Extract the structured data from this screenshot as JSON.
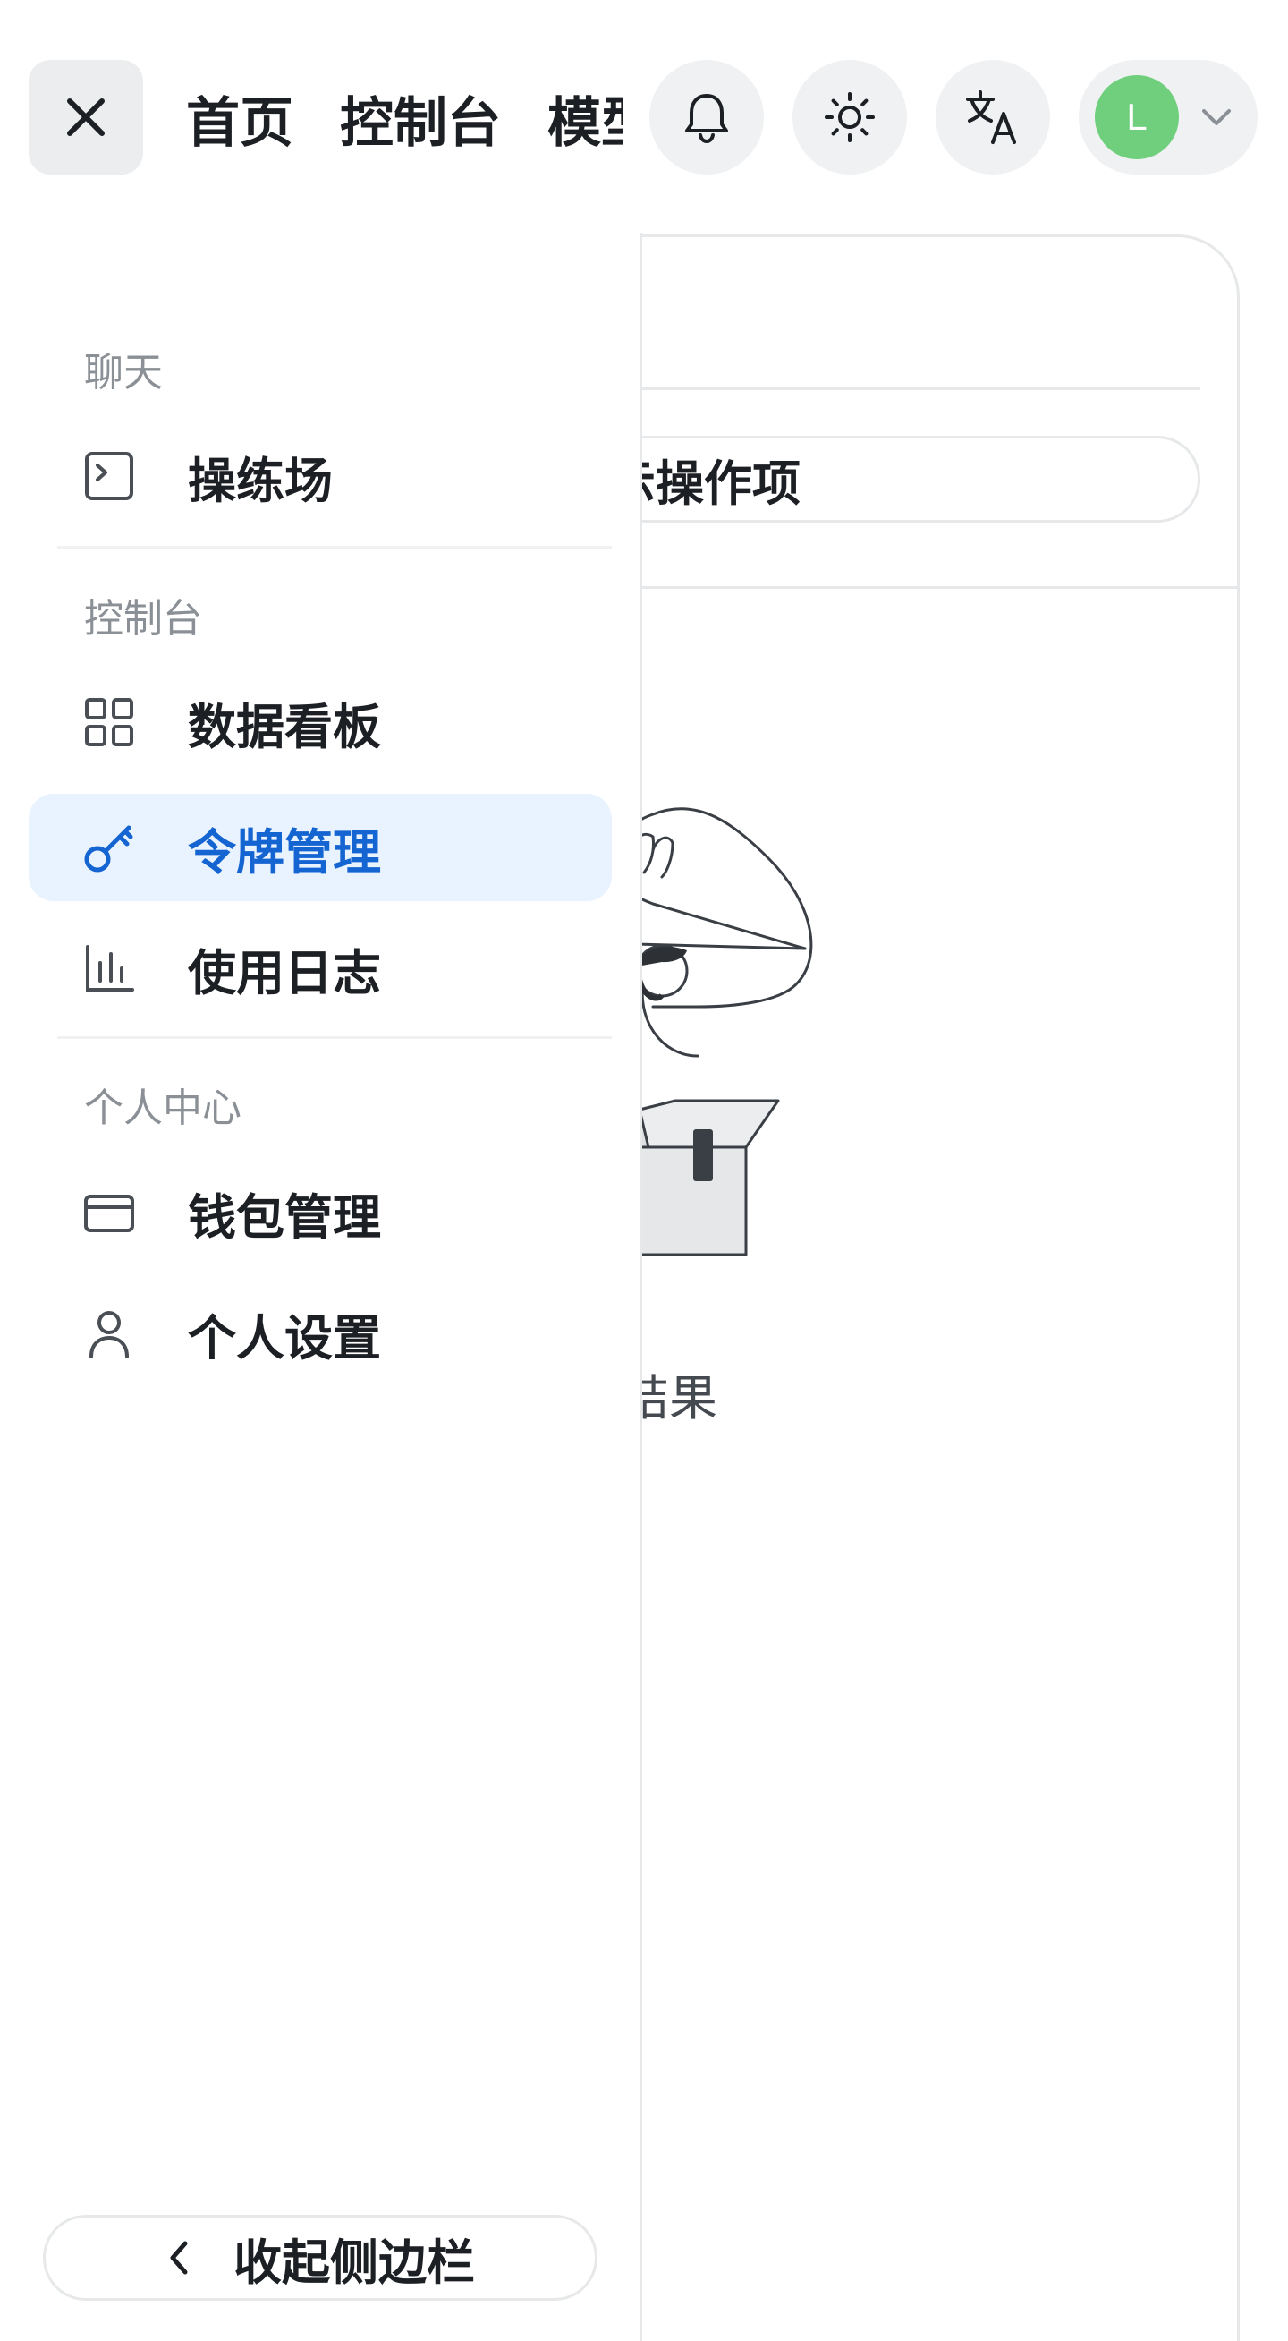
{
  "header": {
    "nav_links": [
      "首页",
      "控制台",
      "模型广场"
    ],
    "avatar_initial": "L",
    "icons": {
      "close": "close-icon",
      "notifications": "bell-icon",
      "theme": "sun-icon",
      "language": "translate-icon",
      "user_menu": "chevron-down-icon"
    }
  },
  "sidebar": {
    "groups": [
      {
        "title": "聊天",
        "items": [
          {
            "label": "操练场",
            "icon": "terminal-icon"
          }
        ]
      },
      {
        "title": "控制台",
        "items": [
          {
            "label": "数据看板",
            "icon": "dashboard-icon"
          },
          {
            "label": "令牌管理",
            "icon": "key-icon",
            "active": true
          },
          {
            "label": "使用日志",
            "icon": "bar-chart-icon"
          }
        ]
      },
      {
        "title": "个人中心",
        "items": [
          {
            "label": "钱包管理",
            "icon": "credit-card-icon"
          },
          {
            "label": "个人设置",
            "icon": "user-icon"
          }
        ]
      }
    ],
    "collapse_label": "收起侧边栏"
  },
  "main": {
    "action_input_visible_text": "示操作项",
    "empty_state_visible_text": "无结果"
  },
  "colors": {
    "accent": "#1464d2",
    "active_bg": "#e8f3ff",
    "avatar_bg": "#6fcf7c",
    "icon_button_bg": "#f0f1f2"
  }
}
